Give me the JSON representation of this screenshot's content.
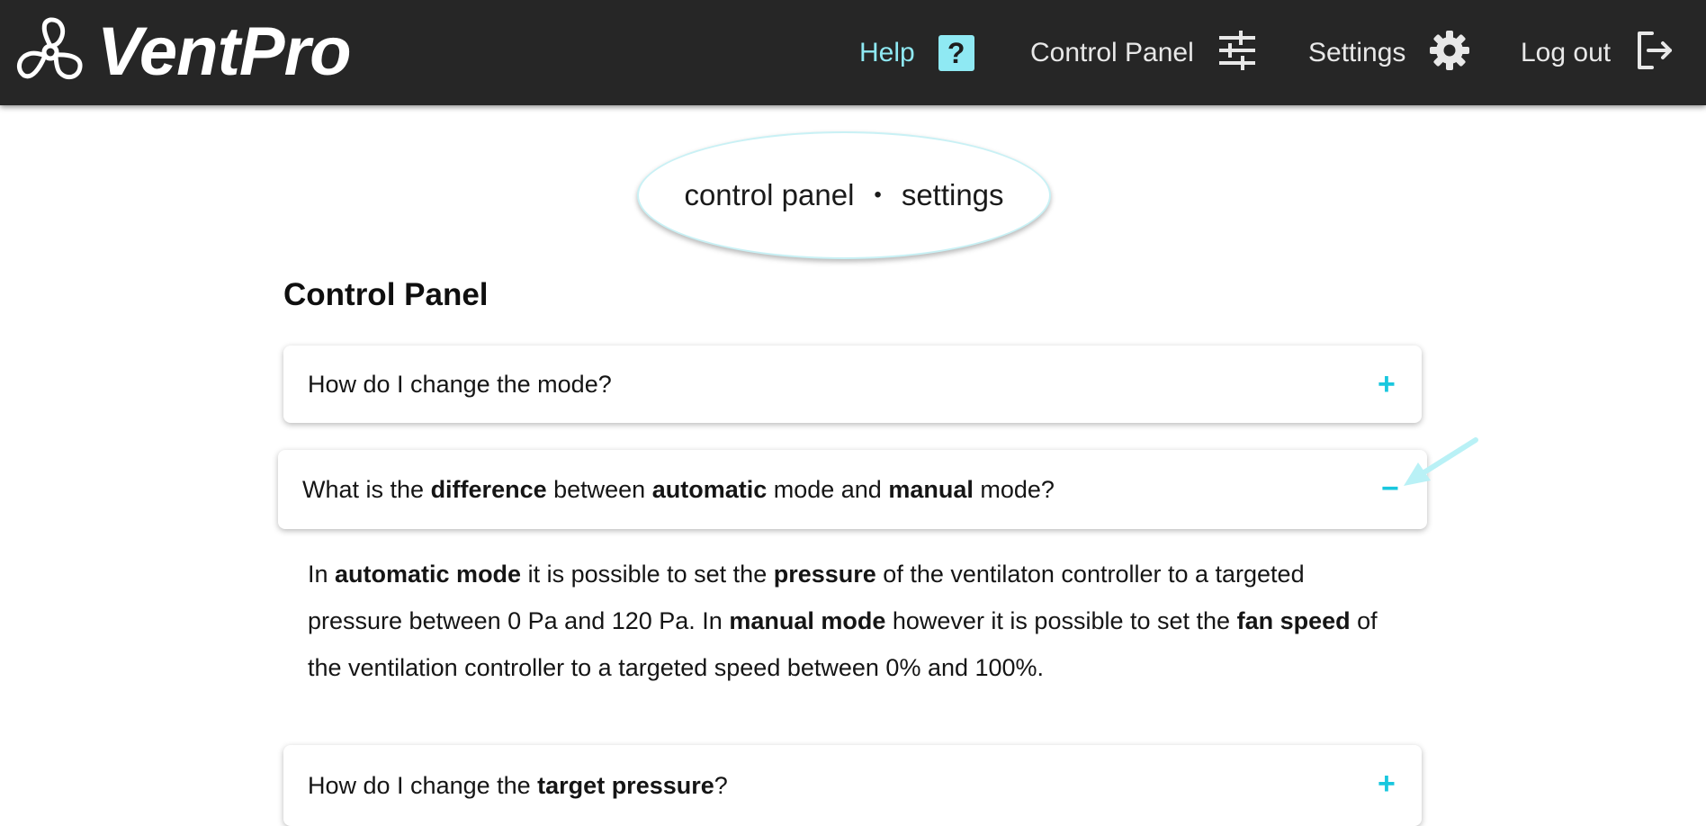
{
  "app": {
    "brand": "VentPro"
  },
  "nav": {
    "help": "Help",
    "help_badge": "?",
    "control_panel": "Control Panel",
    "settings": "Settings",
    "logout": "Log out"
  },
  "breadcrumb": {
    "first": "control panel",
    "separator": "•",
    "second": "settings"
  },
  "section": {
    "title": "Control Panel"
  },
  "faq": {
    "q1": {
      "text": "How do I change the mode?",
      "toggle": "+"
    },
    "q2": {
      "p1": "What is the ",
      "b1": "difference",
      "p2": " between ",
      "b2": "automatic",
      "p3": " mode and ",
      "b3": "manual",
      "p4": " mode?",
      "toggle": "−"
    },
    "answer": {
      "t1": "In ",
      "b1": "automatic mode",
      "t2": " it is possible to set the ",
      "b2": "pressure",
      "t3": " of the ventilaton controller to a targeted pressure between 0 Pa and 120 Pa. In ",
      "b3": "manual mode",
      "t4": " however it is possible to set the ",
      "b4": "fan speed",
      "t5": " of the ventilation controller to a targeted speed between 0% and 100%."
    },
    "q3": {
      "p1": "How do I change the ",
      "b1": "target pressure",
      "p2": "?",
      "toggle": "+"
    }
  },
  "colors": {
    "header_bg": "#262626",
    "accent": "#19c7de",
    "help_accent": "#8fe9f3"
  },
  "icons": {
    "logo": "fan-logo-icon",
    "help": "question-icon",
    "control_panel": "sliders-icon",
    "settings": "gear-icon",
    "logout": "logout-icon"
  }
}
